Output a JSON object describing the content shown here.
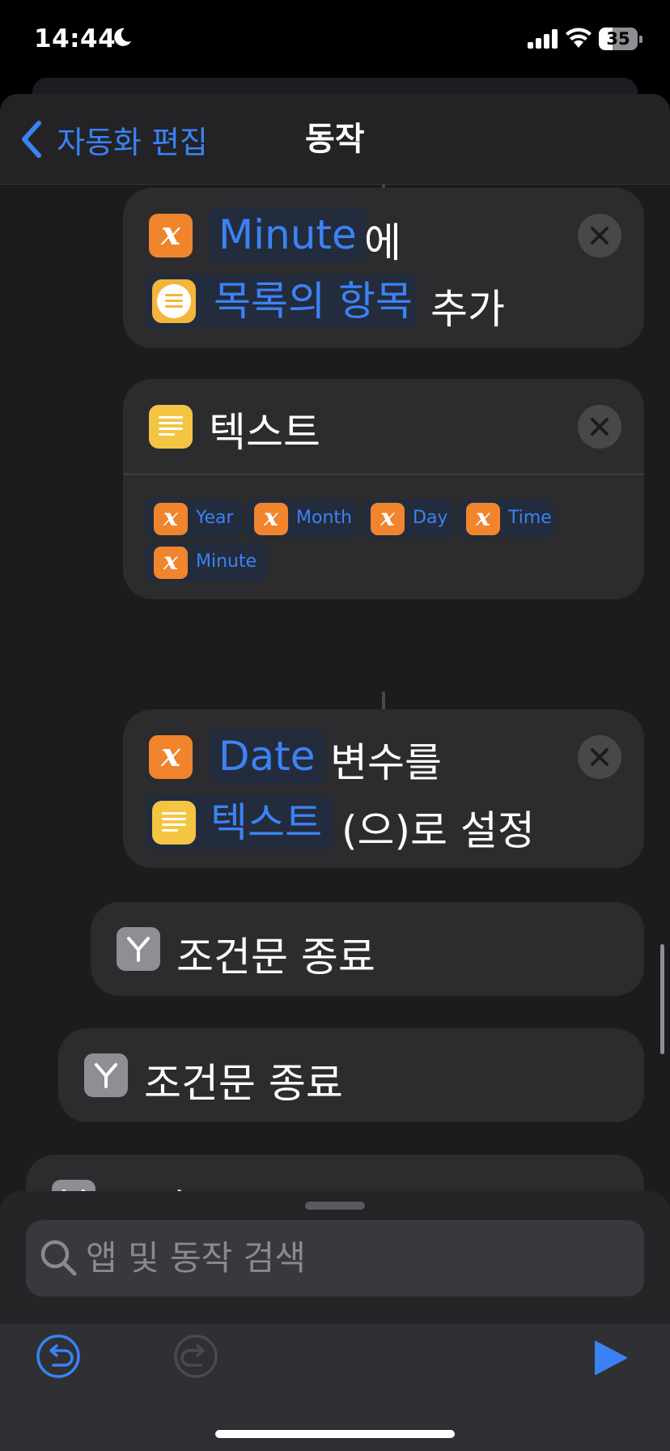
{
  "status_bar": {
    "time": "14:44",
    "battery": "35",
    "icons": [
      "moon-icon",
      "cellular-signal-icon",
      "wifi-icon",
      "battery-icon"
    ]
  },
  "nav": {
    "back_label": "자동화 편집",
    "title": "동작"
  },
  "actions": {
    "add_to_variable": {
      "variable": "Minute",
      "particle": "에",
      "item_chip": "목록의 항목",
      "verb": "추가"
    },
    "text_action": {
      "title": "텍스트",
      "variables": [
        "Year",
        "Month",
        "Day",
        "Time",
        "Minute"
      ]
    },
    "set_variable": {
      "variable": "Date",
      "particle": "변수를",
      "value_chip": "텍스트",
      "verb": "(으)로 설정"
    },
    "end_if": [
      "조건문 종료",
      "조건문 종료",
      "조건문 종료"
    ]
  },
  "search": {
    "placeholder": "앱 및 동작 검색"
  },
  "toolbar": {
    "icons": [
      "undo-icon",
      "redo-icon",
      "play-icon"
    ]
  },
  "colors": {
    "accent": "#3a82f6",
    "variable_orange": "#f0852d",
    "text_yellow": "#f4c542",
    "card": "#2c2c2e",
    "background": "#1c1c1e"
  }
}
